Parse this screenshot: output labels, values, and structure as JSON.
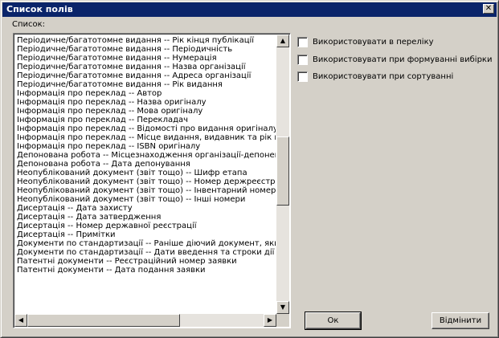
{
  "window": {
    "title": "Список полів"
  },
  "list": {
    "caption": "Список:",
    "items": [
      "Періодичне/багатотомне видання -- Рік кінця публікації",
      "Періодичне/багатотомне видання -- Періодичність",
      "Періодичне/багатотомне видання -- Нумерація",
      "Періодичне/багатотомне видання -- Назва організації",
      "Періодичне/багатотомне видання -- Адреса організації",
      "Періодичне/багатотомне видання -- Рік видання",
      "Інформація про переклад -- Автор",
      "Інформація про переклад -- Назва оригіналу",
      "Інформація про переклад -- Мова оригіналу",
      "Інформація про переклад -- Перекладач",
      "Інформація про переклад -- Відомості про видання оригіналу",
      "Інформація про переклад -- Місце видання, видавник та рік вид",
      "Інформація про переклад -- ISBN оригіналу",
      "Депонована робота -- Місцезнаходження організації-депонента",
      "Депонована робота -- Дата депонування",
      "Неопублікований документ (звіт тощо) -- Шифр етапа",
      "Неопублікований документ (звіт тощо) -- Номер держреєстрації",
      "Неопублікований документ (звіт тощо) -- Інвентарний номер",
      "Неопублікований документ (звіт тощо) -- Інші номери",
      "Дисертація -- Дата захисту",
      "Дисертація -- Дата затвердження",
      "Дисертація -- Номер державної реєстрації",
      "Дисертація -- Примітки",
      "Документи по стандартизації -- Раніше діючий документ, якщо",
      "Документи по стандартизації -- Дати введення та строки дії до",
      "Патентні документи -- Реєстраційний номер заявки",
      "Патентні документи -- Дата подання заявки"
    ]
  },
  "options": [
    {
      "label": "Використовувати в переліку",
      "checked": false
    },
    {
      "label": "Використовувати при формуванні вибірки",
      "checked": false
    },
    {
      "label": "Використовувати при сортуванні",
      "checked": false
    }
  ],
  "buttons": {
    "ok": "Ок",
    "cancel": "Відмінити"
  },
  "colors": {
    "titlebar": "#0a246a",
    "face": "#d4d0c8"
  }
}
